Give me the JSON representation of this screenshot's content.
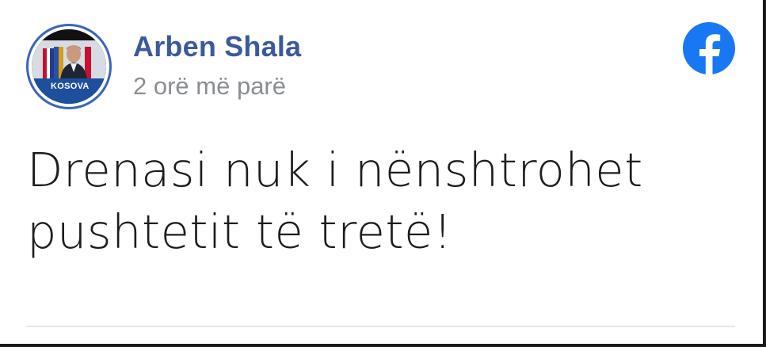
{
  "post": {
    "author": "Arben Shala",
    "time": "2 orë më parë",
    "text_lines": [
      "Drenasi nuk i nënshtrohet",
      "pushtetit të tretë!"
    ],
    "avatar_badge": "KOSOVA"
  },
  "icons": {
    "platform": "facebook-icon"
  },
  "colors": {
    "author": "#3a5a9a",
    "facebook_blue": "#1877f2",
    "avatar_ring": "#3a65b8",
    "timestamp": "#8a8d91"
  }
}
